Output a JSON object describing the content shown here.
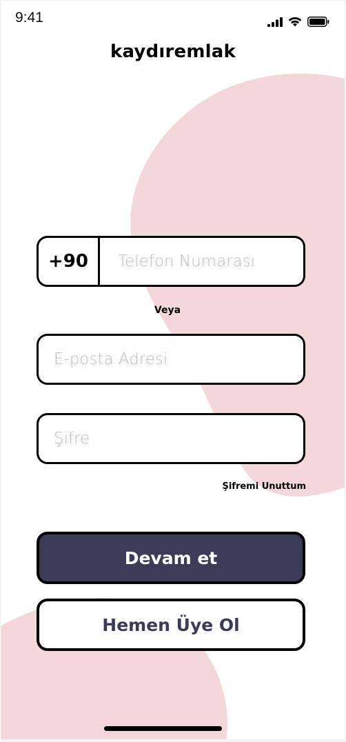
{
  "status_bar": {
    "time": "9:41",
    "icons": [
      "cellular-signal-icon",
      "wifi-icon",
      "battery-icon"
    ]
  },
  "app": {
    "title": "kaydıremlak"
  },
  "phone": {
    "country_code": "+90",
    "placeholder": "Telefon Numarası",
    "value": ""
  },
  "separator": "Veya",
  "email": {
    "placeholder": "E-posta Adresi",
    "value": ""
  },
  "password": {
    "placeholder": "Şifre",
    "value": ""
  },
  "forgot_password": "Şifremi Unuttum",
  "buttons": {
    "continue": "Devam et",
    "register": "Hemen Üye Ol"
  },
  "colors": {
    "primary": "#3c3c58",
    "blob": "#f3d7d9",
    "border": "#000000",
    "placeholder": "#c2c2c2"
  }
}
